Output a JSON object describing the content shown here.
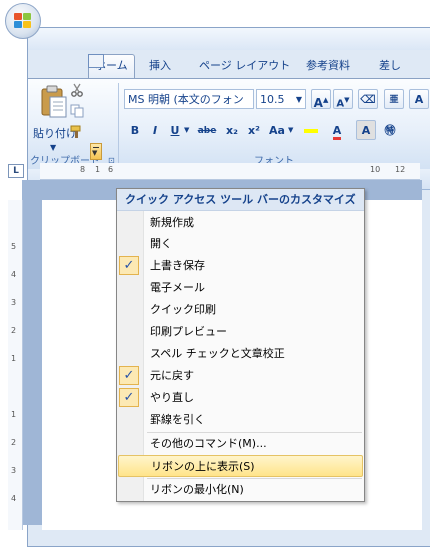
{
  "tabs": [
    {
      "label": "ホーム",
      "active": true
    },
    {
      "label": "挿入"
    },
    {
      "label": "ページ レイアウト"
    },
    {
      "label": "参考資料"
    },
    {
      "label": "差し"
    }
  ],
  "clipboard": {
    "paste_label": "貼り付け",
    "group_label": "クリップボード"
  },
  "font": {
    "font_name": "MS 明朝 (本文のフォン",
    "font_size": "10.5",
    "group_label": "フォント",
    "bold": "B",
    "italic": "I",
    "underline": "U",
    "strike": "abe",
    "subscript": "x₂",
    "superscript": "x²",
    "change_case": "Aa",
    "grow": "A",
    "shrink": "A"
  },
  "ruler": {
    "corner": "L",
    "h_numbers": [
      "8",
      "1",
      "6"
    ],
    "h_numbers_right": [
      "10",
      "12"
    ],
    "v_numbers": [
      "5",
      "4",
      "3",
      "2",
      "1",
      "1",
      "2",
      "3",
      "4"
    ]
  },
  "menu": {
    "title": "クイック アクセス ツール バーのカスタマイズ",
    "items": [
      {
        "label": "新規作成",
        "checked": false
      },
      {
        "label": "開く",
        "checked": false
      },
      {
        "label": "上書き保存",
        "checked": true
      },
      {
        "label": "電子メール",
        "checked": false
      },
      {
        "label": "クイック印刷",
        "checked": false
      },
      {
        "label": "印刷プレビュー",
        "checked": false
      },
      {
        "label": "スペル チェックと文章校正",
        "checked": false
      },
      {
        "label": "元に戻す",
        "checked": true
      },
      {
        "label": "やり直し",
        "checked": true
      },
      {
        "label": "罫線を引く",
        "checked": false
      },
      {
        "label": "その他のコマンド(M)...",
        "checked": false
      },
      {
        "label": "リボンの上に表示(S)",
        "checked": false,
        "highlighted": true
      },
      {
        "label": "リボンの最小化(N)",
        "checked": false
      }
    ],
    "check_mark": "✓"
  },
  "colors": {
    "accent": "#15428b",
    "highlight": "#ffe48a",
    "ribbon": "#dfe9f5",
    "document_bg": "#9fb6d6"
  }
}
